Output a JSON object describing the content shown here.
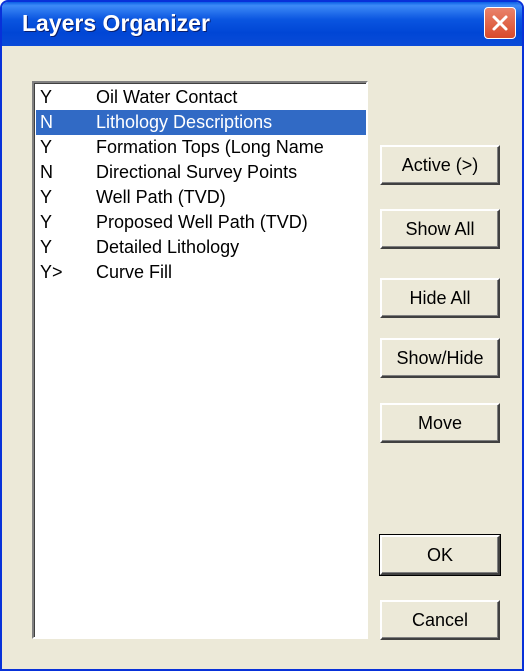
{
  "window": {
    "title": "Layers Organizer"
  },
  "icons": {
    "close": "close-icon"
  },
  "layers": [
    {
      "flag": "Y",
      "name": "Oil Water Contact",
      "selected": false
    },
    {
      "flag": "N",
      "name": "Lithology Descriptions",
      "selected": true
    },
    {
      "flag": "Y",
      "name": "Formation Tops (Long Name",
      "selected": false
    },
    {
      "flag": "N",
      "name": "Directional Survey Points",
      "selected": false
    },
    {
      "flag": "Y",
      "name": "Well Path (TVD)",
      "selected": false
    },
    {
      "flag": "Y",
      "name": "Proposed Well Path (TVD)",
      "selected": false
    },
    {
      "flag": "Y",
      "name": "Detailed Lithology",
      "selected": false
    },
    {
      "flag": "Y>",
      "name": "Curve Fill",
      "selected": false
    }
  ],
  "buttons": {
    "active": "Active (>)",
    "show_all": "Show All",
    "hide_all": "Hide All",
    "show_hide": "Show/Hide",
    "move": "Move",
    "ok": "OK",
    "cancel": "Cancel"
  },
  "colors": {
    "selection": "#316ac5",
    "titlebar": "#0a55e0",
    "dialog_bg": "#ece9d8",
    "close_button": "#d84a2a"
  }
}
